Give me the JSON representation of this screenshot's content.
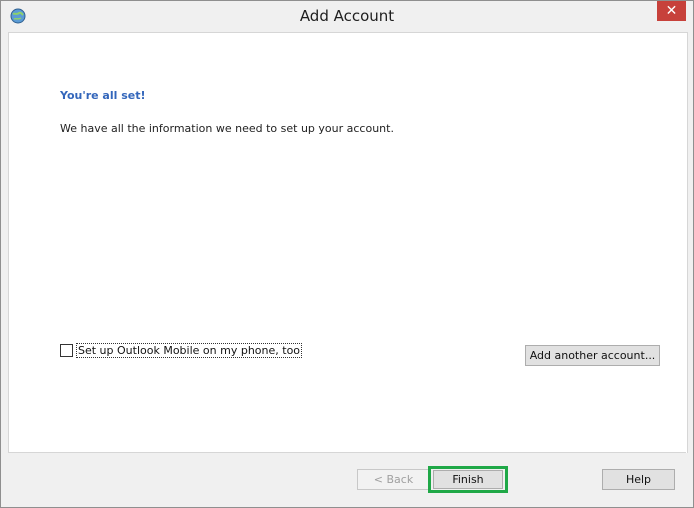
{
  "window": {
    "title": "Add Account",
    "close_label": "✕"
  },
  "content": {
    "heading": "You're all set!",
    "info": "We have all the information we need to set up your account.",
    "checkbox_label": "Set up Outlook Mobile on my phone, too",
    "checkbox_checked": false,
    "add_another_label": "Add another account..."
  },
  "footer": {
    "back_label": "< Back",
    "finish_label": "Finish",
    "help_label": "Help"
  },
  "colors": {
    "heading": "#3366bb",
    "close_bg": "#c7413b",
    "highlight": "#1fa847"
  }
}
